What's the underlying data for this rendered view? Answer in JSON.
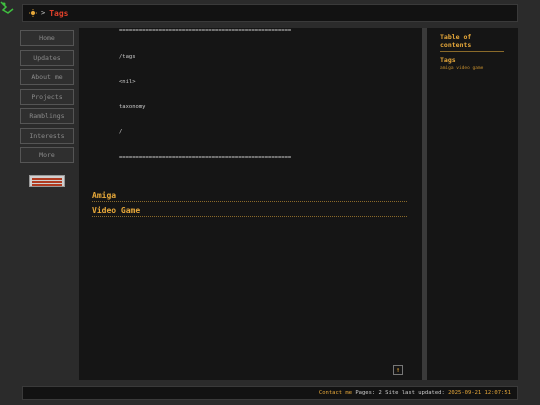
{
  "breadcrumb": {
    "separator": ">",
    "current": "Tags"
  },
  "sidebar": {
    "items": [
      {
        "label": "Home"
      },
      {
        "label": "Updates"
      },
      {
        "label": "About me"
      },
      {
        "label": "Projects"
      },
      {
        "label": "Ramblings"
      },
      {
        "label": "Interests"
      },
      {
        "label": "More"
      }
    ]
  },
  "frontmatter": {
    "rule": "====================================================",
    "lines": [
      "/tags",
      "<nil>",
      "taxonomy",
      "/"
    ]
  },
  "taxonomies": [
    "Amiga",
    "Video Game"
  ],
  "back_to_top": "↑",
  "toc": {
    "title": "Table of contents",
    "item": "Tags",
    "sub": "amiga video game"
  },
  "footer": {
    "contact": "Contact me",
    "pages_text": "Pages: 2 Site last updated:",
    "updated": "2025-09-21 12:07:51"
  },
  "colors": {
    "accent": "#e8a93a",
    "crumb": "#e0402a"
  }
}
